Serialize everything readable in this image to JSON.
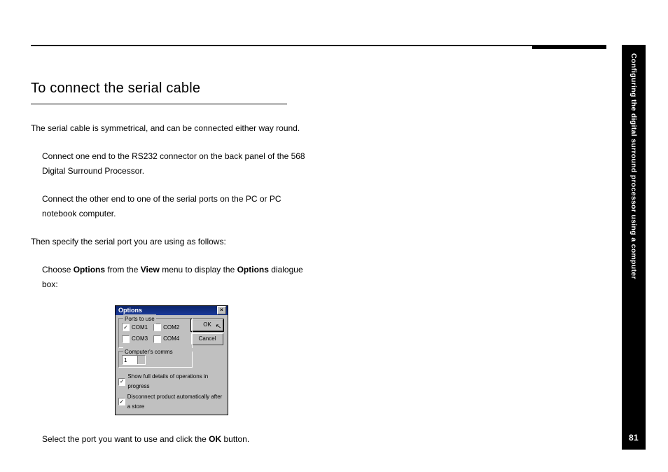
{
  "sidebar": {
    "chapter": "Configuring the digital surround processor using a computer",
    "page": "81"
  },
  "heading": "To connect the serial cable",
  "paragraphs": {
    "intro": "The serial cable is symmetrical, and can be connected either way round.",
    "step1": "Connect one end to the RS232 connector on the back panel of the 568 Digital Surround Processor.",
    "step2": "Connect the other end to one of the serial ports on the PC or PC notebook computer.",
    "then": "Then specify the serial port you are using as follows:",
    "choose_pre": "Choose ",
    "choose_b1": "Options",
    "choose_mid1": " from the ",
    "choose_b2": "View",
    "choose_mid2": " menu to display the ",
    "choose_b3": "Options",
    "choose_post": " dialogue box:",
    "select_pre": "Select the port you want to use and click the ",
    "select_b": "OK",
    "select_post": " button."
  },
  "dialog": {
    "title": "Options",
    "group1_label": "Ports to use",
    "com1": "COM1",
    "com2": "COM2",
    "com3": "COM3",
    "com4": "COM4",
    "group2_label": "Computer's comms address",
    "addr_value": "1",
    "btn_ok": "OK",
    "btn_cancel": "Cancel",
    "chk1": "Show full details of operations in progress",
    "chk2": "Disconnect product automatically after a store"
  }
}
